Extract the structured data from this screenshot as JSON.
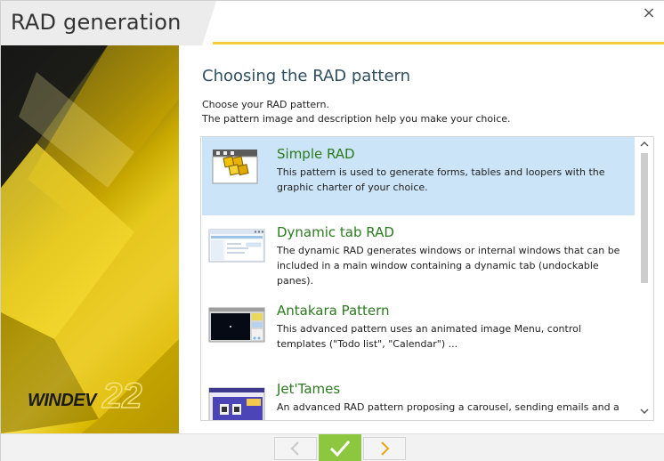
{
  "window": {
    "title": "RAD generation",
    "close_glyph": "×"
  },
  "banner": {
    "logo_text": "WINDEV",
    "logo_version": "22"
  },
  "page": {
    "heading": "Choosing the RAD pattern",
    "description_line1": "Choose your RAD pattern.",
    "description_line2": "The pattern image and description help you make your choice."
  },
  "patterns": [
    {
      "name": "Simple RAD",
      "description": "This pattern is used to generate forms, tables and loopers with the graphic charter of your choice.",
      "selected": true
    },
    {
      "name": "Dynamic tab RAD",
      "description": "The dynamic RAD generates windows or internal windows that can be included in a main window containing a dynamic tab (undockable panes).",
      "selected": false
    },
    {
      "name": "Antakara Pattern",
      "description": "This advanced pattern uses an animated image Menu, control templates (\"Todo list\", \"Calendar\") ...",
      "selected": false
    },
    {
      "name": "Jet'Tames",
      "description": "An advanced RAD pattern proposing a carousel, sending emails and a",
      "selected": false
    }
  ],
  "scrollbar": {
    "up_glyph": "^",
    "down_glyph": "v"
  },
  "footer": {
    "prev_glyph": "‹",
    "ok_glyph": "✓",
    "next_glyph": "›"
  },
  "colors": {
    "accent_gold": "#f3cf3c",
    "selection": "#cce4f7",
    "pattern_name": "#2b7a1f",
    "ok_button": "#8dc63f",
    "next_arrow": "#e8a317"
  },
  "icons": {
    "close": "close-icon",
    "previous": "chevron-left-icon",
    "validate": "checkmark-icon",
    "next": "chevron-right-icon",
    "scroll_up": "chevron-up-icon",
    "scroll_down": "chevron-down-icon"
  }
}
